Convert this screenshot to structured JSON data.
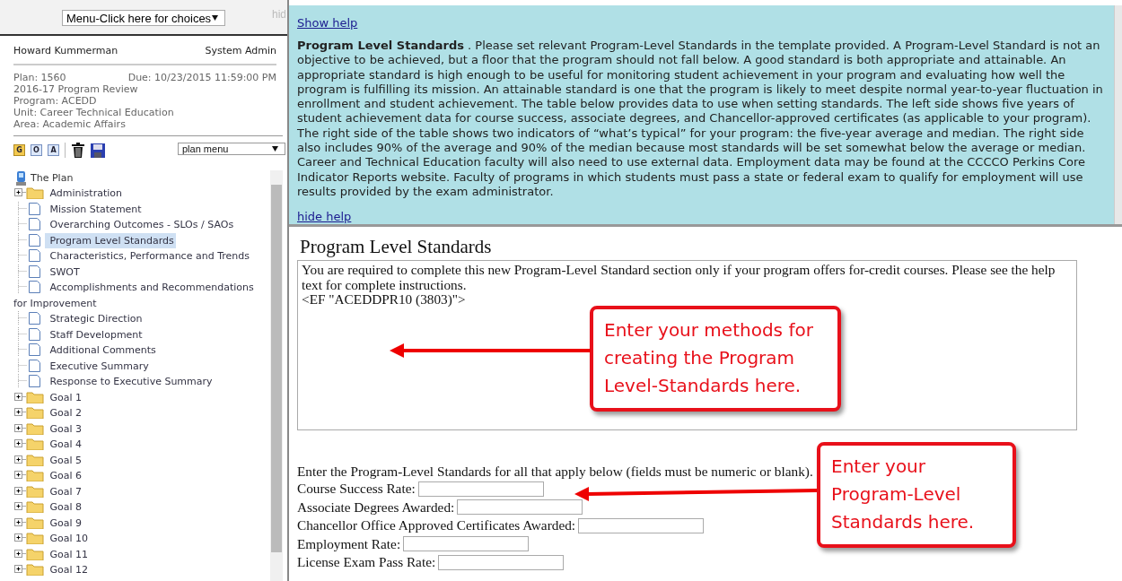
{
  "top_menu": {
    "value": "Menu-Click here for choices",
    "cut_label": "hid"
  },
  "user": {
    "name": "Howard Kummerman",
    "role": "System Admin"
  },
  "plan": {
    "number": "Plan: 1560",
    "due": "Due: 10/23/2015 11:59:00 PM",
    "lines": [
      "2016-17 Program Review",
      "Program: ACEDD",
      "Unit: Career Technical Education",
      "Area: Academic Affairs"
    ]
  },
  "toolbar": {
    "buttons": [
      {
        "kind": "g",
        "label": "G"
      },
      {
        "kind": "o",
        "label": "O"
      },
      {
        "kind": "a",
        "label": "A"
      },
      {
        "kind": "trash"
      },
      {
        "kind": "save"
      }
    ],
    "plan_menu": "plan menu"
  },
  "tree": {
    "root": "The Plan",
    "items": [
      {
        "kind": "folder",
        "label": "Administration",
        "selected": false
      },
      {
        "kind": "doc",
        "label": "Mission Statement",
        "selected": false
      },
      {
        "kind": "doc",
        "label": "Overarching Outcomes - SLOs / SAOs",
        "selected": false
      },
      {
        "kind": "doc",
        "label": "Program Level Standards",
        "selected": true
      },
      {
        "kind": "doc",
        "label": "Characteristics, Performance and Trends",
        "selected": false
      },
      {
        "kind": "doc",
        "label": "SWOT",
        "selected": false
      },
      {
        "kind": "doc",
        "label": "Accomplishments and Recommendations for Improvement",
        "selected": false
      },
      {
        "kind": "doc",
        "label": "Strategic Direction",
        "selected": false
      },
      {
        "kind": "doc",
        "label": "Staff Development",
        "selected": false
      },
      {
        "kind": "doc",
        "label": "Additional Comments",
        "selected": false
      },
      {
        "kind": "doc",
        "label": "Executive Summary",
        "selected": false
      },
      {
        "kind": "doc",
        "label": "Response to Executive Summary",
        "selected": false
      },
      {
        "kind": "folder",
        "label": "Goal 1",
        "selected": false
      },
      {
        "kind": "folder",
        "label": "Goal 2",
        "selected": false
      },
      {
        "kind": "folder",
        "label": "Goal 3",
        "selected": false
      },
      {
        "kind": "folder",
        "label": "Goal 4",
        "selected": false
      },
      {
        "kind": "folder",
        "label": "Goal 5",
        "selected": false
      },
      {
        "kind": "folder",
        "label": "Goal 6",
        "selected": false
      },
      {
        "kind": "folder",
        "label": "Goal 7",
        "selected": false
      },
      {
        "kind": "folder",
        "label": "Goal 8",
        "selected": false
      },
      {
        "kind": "folder",
        "label": "Goal 9",
        "selected": false
      },
      {
        "kind": "folder",
        "label": "Goal 10",
        "selected": false
      },
      {
        "kind": "folder",
        "label": "Goal 11",
        "selected": false
      },
      {
        "kind": "folder",
        "label": "Goal 12",
        "selected": false
      }
    ]
  },
  "help": {
    "show_link": "Show help",
    "text": "**Program Level Standards** . Please set relevant Program-Level Standards in the template provided. A Program-Level Standard is not an objective to be achieved, but a floor that the program should not fall below. A good standard is both appropriate and attainable. An appropriate standard is high enough to be useful for monitoring student achievement in your program and evaluating how well the program is fulfilling its mission. An attainable standard is one that the program is likely to meet despite normal year-to-year fluctuation in enrollment and student achievement. The table below provides data to use when setting standards. The left side shows five years of student achievement data for course success, associate degrees, and Chancellor-approved certificates (as applicable to your program). The right side of the table shows two indicators of “what’s typical” for your program: the five-year average and median. The right side also includes 90% of the average and 90% of the median because most standards will be set somewhat below the average or median. Career and Technical Education faculty will also need to use external data. Employment data may be found at the CCCCO Perkins Core Indicator Reports website. Faculty of programs in which students must pass a state or federal exam to qualify for employment will use results provided by the exam administrator.",
    "hide_link": "hide help"
  },
  "section": {
    "title": "Program Level Standards",
    "box_lines": [
      "You are required to complete this new Program-Level Standard section only if your program offers for-credit courses. Please see the help text for complete instructions.",
      "<EF \"ACEDDPR10 (3803)\">"
    ],
    "instruction": "Enter the Program-Level Standards for all that apply below (fields must be numeric or blank).",
    "fields": [
      "Course Success Rate:",
      "Associate Degrees Awarded:",
      "Chancellor Office Approved Certificates Awarded:",
      "Employment Rate:",
      "License Exam Pass Rate:"
    ]
  },
  "callouts": [
    "Enter your methods for creating the Program Level-Standards here.",
    "Enter your Program-Level Standards here."
  ]
}
